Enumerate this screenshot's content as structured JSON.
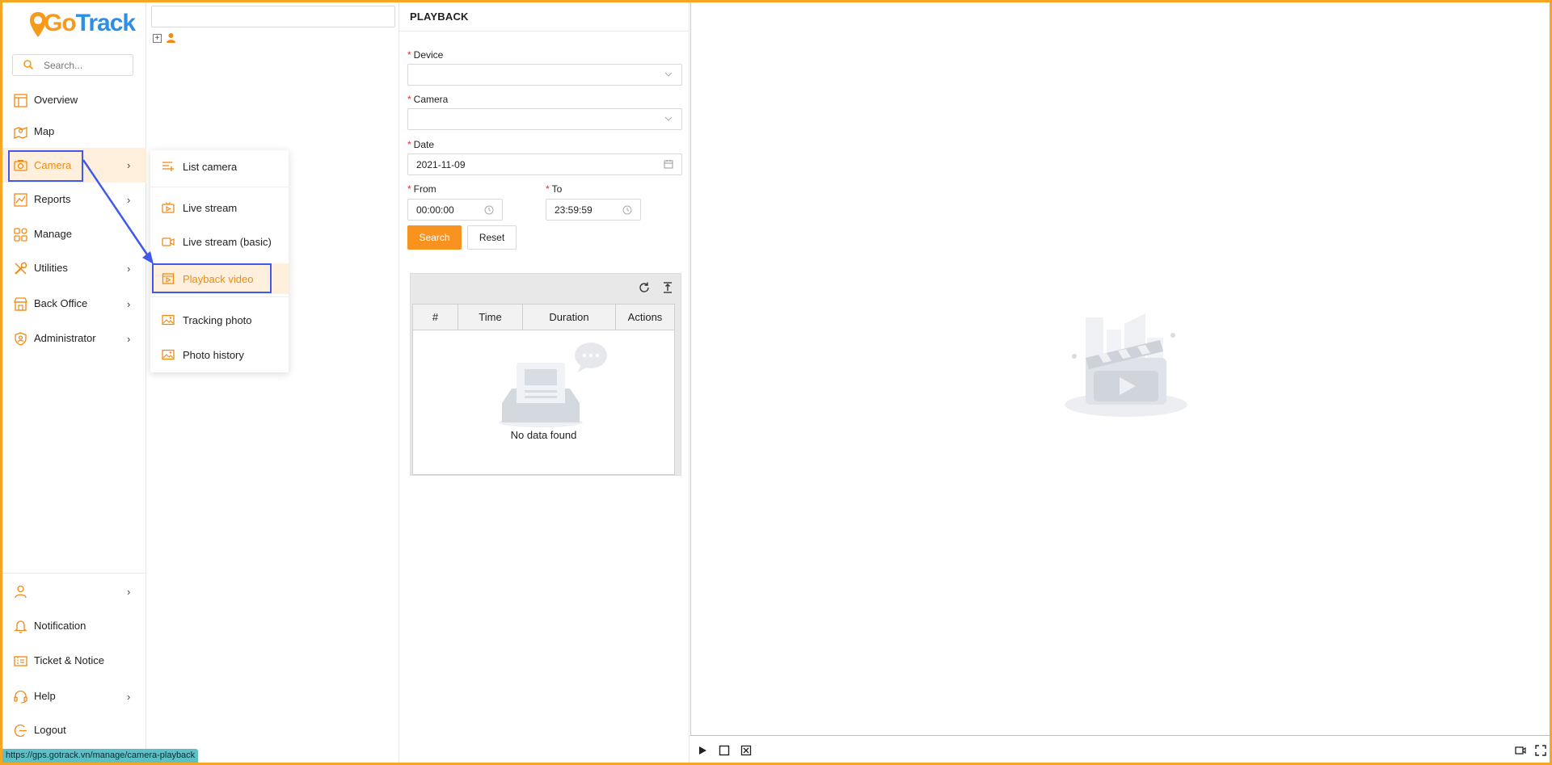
{
  "app": {
    "logo_go": "Go",
    "logo_track": "Track"
  },
  "sidebar": {
    "search_placeholder": "Search...",
    "items": [
      {
        "label": "Overview",
        "icon": "layout-icon",
        "has_chevron": false
      },
      {
        "label": "Map",
        "icon": "map-icon",
        "has_chevron": false
      },
      {
        "label": "Camera",
        "icon": "camera-icon",
        "has_chevron": true,
        "active": true
      },
      {
        "label": "Reports",
        "icon": "chart-line-icon",
        "has_chevron": true
      },
      {
        "label": "Manage",
        "icon": "grid-icon",
        "has_chevron": false
      },
      {
        "label": "Utilities",
        "icon": "tools-icon",
        "has_chevron": true
      },
      {
        "label": "Back Office",
        "icon": "store-icon",
        "has_chevron": true
      },
      {
        "label": "Administrator",
        "icon": "shield-user-icon",
        "has_chevron": true
      }
    ],
    "bottom": [
      {
        "label": "",
        "icon": "user-icon",
        "has_chevron": true
      },
      {
        "label": "Notification",
        "icon": "bell-icon",
        "has_chevron": false
      },
      {
        "label": "Ticket & Notice",
        "icon": "ticket-icon",
        "has_chevron": false
      },
      {
        "label": "Help",
        "icon": "headset-icon",
        "has_chevron": true
      },
      {
        "label": "Logout",
        "icon": "logout-icon",
        "has_chevron": false
      }
    ]
  },
  "submenu": {
    "items": [
      {
        "label": "List camera",
        "icon": "list-add-icon"
      },
      {
        "label": "Live stream",
        "icon": "live-icon"
      },
      {
        "label": "Live stream (basic)",
        "icon": "video-icon"
      },
      {
        "label": "Playback video",
        "icon": "playback-icon",
        "active": true
      },
      {
        "label": "Tracking photo",
        "icon": "image-icon"
      },
      {
        "label": "Photo history",
        "icon": "image-icon"
      }
    ]
  },
  "form": {
    "title": "PLAYBACK",
    "required_mark": "*",
    "device_label": "Device",
    "device_value": "",
    "camera_label": "Camera",
    "camera_value": "",
    "date_label": "Date",
    "date_value": "2021-11-09",
    "from_label": "From",
    "from_value": "00:00:00",
    "to_label": "To",
    "to_value": "23:59:59",
    "search_button": "Search",
    "reset_button": "Reset"
  },
  "table": {
    "columns": [
      "#",
      "Time",
      "Duration",
      "Actions"
    ],
    "empty_text": "No data found"
  },
  "status_url": "https://gps.gotrack.vn/manage/camera-playback",
  "colors": {
    "accent": "#f7931e",
    "active_bg": "#fef0dc",
    "highlight": "#4258e8",
    "frame": "#f6a623"
  }
}
